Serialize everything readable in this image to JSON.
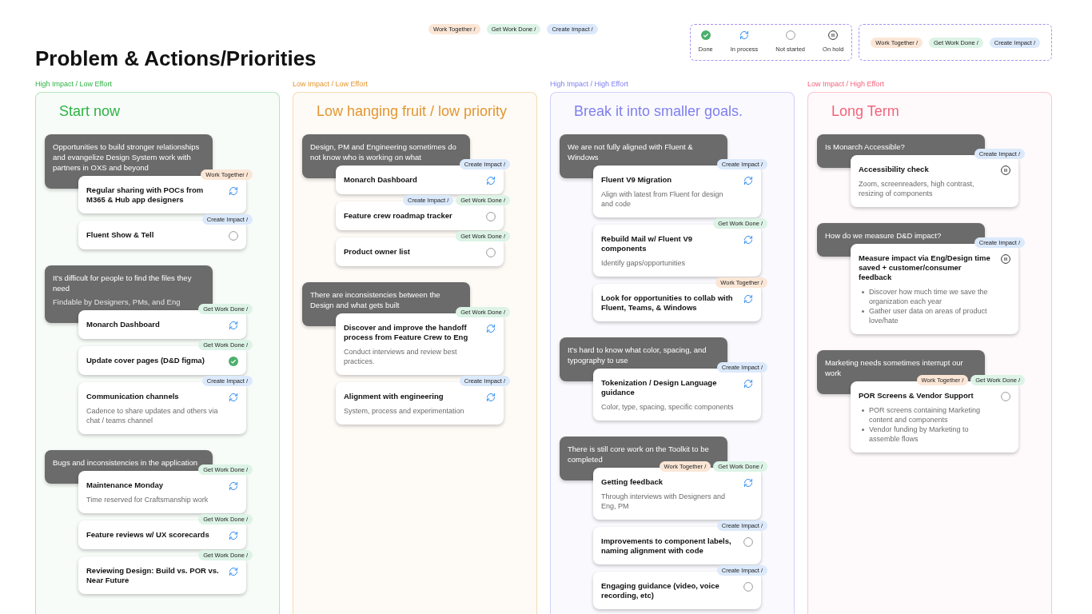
{
  "header_tags": [
    {
      "label": "Work Together /",
      "kind": "together"
    },
    {
      "label": "Get Work Done /",
      "kind": "done"
    },
    {
      "label": "Create Impact /",
      "kind": "impact"
    }
  ],
  "title": "Problem & Actions/Priorities",
  "legend": {
    "statuses": [
      {
        "label": "Done",
        "kind": "done"
      },
      {
        "label": "In process",
        "kind": "in_process"
      },
      {
        "label": "Not started",
        "kind": "not_started"
      },
      {
        "label": "On hold",
        "kind": "on_hold"
      }
    ],
    "tags": [
      {
        "label": "Work Together /",
        "kind": "together"
      },
      {
        "label": "Get Work Done /",
        "kind": "done"
      },
      {
        "label": "Create Impact /",
        "kind": "impact"
      }
    ]
  },
  "columns": [
    {
      "category": "High Impact / Low Effort",
      "heading": "Start now",
      "color": "#2fb344",
      "groups": [
        {
          "problem": "Opportunities to build stronger relationships and evangelize Design System work with partners in OXS and beyond",
          "cards": [
            {
              "title": "Regular sharing with POCs from M365 & Hub app designers",
              "kind": "in_process",
              "tags": [
                {
                  "label": "Work Together /",
                  "kind": "together"
                }
              ]
            },
            {
              "title": "Fluent Show & Tell",
              "kind": "not_started",
              "tags": [
                {
                  "label": "Create Impact /",
                  "kind": "impact"
                }
              ]
            }
          ]
        },
        {
          "problem": "It’s difficult for people to find the files they need",
          "note": "Findable by Designers, PMs, and Eng",
          "cards": [
            {
              "title": "Monarch Dashboard",
              "kind": "in_process",
              "tags": [
                {
                  "label": "Get Work Done /",
                  "kind": "done"
                }
              ]
            },
            {
              "title": "Update cover pages (D&D figma)",
              "kind": "done",
              "tags": [
                {
                  "label": "Get Work Done /",
                  "kind": "done"
                }
              ]
            },
            {
              "title": "Communication channels",
              "description": "Cadence to share updates and others via chat / teams channel",
              "kind": "in_process",
              "tags": [
                {
                  "label": "Create Impact /",
                  "kind": "impact"
                }
              ]
            }
          ]
        },
        {
          "problem": "Bugs and inconsistencies in the application",
          "cards": [
            {
              "title": "Maintenance Monday",
              "description": "Time reserved for Craftsmanship work",
              "kind": "in_process",
              "tags": [
                {
                  "label": "Get Work Done /",
                  "kind": "done"
                }
              ]
            },
            {
              "title": "Feature reviews w/ UX scorecards",
              "kind": "in_process",
              "tags": [
                {
                  "label": "Get Work Done /",
                  "kind": "done"
                }
              ]
            },
            {
              "title": "Reviewing Design: Build vs. POR vs. Near Future",
              "kind": "in_process",
              "tags": [
                {
                  "label": "Get Work Done /",
                  "kind": "done"
                }
              ]
            }
          ]
        }
      ]
    },
    {
      "category": "Low Impact / Low Effort",
      "heading": "Low hanging fruit / low priority",
      "color": "#e3962f",
      "groups": [
        {
          "problem": "Design, PM and Engineering sometimes do not know who is working on what",
          "cards": [
            {
              "title": "Monarch Dashboard",
              "kind": "in_process",
              "tags": [
                {
                  "label": "Create Impact /",
                  "kind": "impact"
                }
              ]
            },
            {
              "title": "Feature crew roadmap tracker",
              "kind": "not_started",
              "tags": [
                {
                  "label": "Create Impact /",
                  "kind": "impact"
                },
                {
                  "label": "Get Work Done /",
                  "kind": "done"
                }
              ]
            },
            {
              "title": "Product owner list",
              "kind": "not_started",
              "tags": [
                {
                  "label": "Get Work Done /",
                  "kind": "done"
                }
              ]
            }
          ]
        },
        {
          "problem": "There are inconsistencies between the Design and what gets built",
          "cards": [
            {
              "title": "Discover and improve the handoff process from Feature Crew to Eng",
              "description": "Conduct interviews and review best practices.",
              "kind": "in_process",
              "tags": [
                {
                  "label": "Get Work Done /",
                  "kind": "done"
                }
              ]
            },
            {
              "title": "Alignment with engineering",
              "description": "System, process and experimentation",
              "kind": "in_process",
              "tags": [
                {
                  "label": "Create Impact /",
                  "kind": "impact"
                }
              ]
            }
          ]
        }
      ]
    },
    {
      "category": "High Impact / High Effort",
      "heading": "Break it into smaller goals.",
      "color": "#7f7ff0",
      "groups": [
        {
          "problem": "We are not fully aligned with Fluent & Windows",
          "cards": [
            {
              "title": "Fluent V9 Migration",
              "description": "Align with latest from Fluent for design and code",
              "kind": "in_process",
              "tags": [
                {
                  "label": "Create Impact /",
                  "kind": "impact"
                }
              ]
            },
            {
              "title": "Rebuild Mail w/ Fluent V9 components",
              "description": "Identify gaps/opportunities",
              "kind": "in_process",
              "tags": [
                {
                  "label": "Get Work Done /",
                  "kind": "done"
                }
              ]
            },
            {
              "title": "Look for opportunities to collab with Fluent, Teams, & Windows",
              "kind": "in_process",
              "tags": [
                {
                  "label": "Work Together /",
                  "kind": "together"
                }
              ]
            }
          ]
        },
        {
          "problem": "It’s hard to know what color, spacing, and typography to use",
          "cards": [
            {
              "title": "Tokenization / Design Language guidance",
              "description": "Color, type, spacing, specific components",
              "kind": "in_process",
              "tags": [
                {
                  "label": "Create Impact /",
                  "kind": "impact"
                }
              ]
            }
          ]
        },
        {
          "problem": "There is still core work on the Toolkit to be completed",
          "cards": [
            {
              "title": "Getting feedback",
              "description": "Through interviews with Designers and Eng, PM",
              "kind": "in_process",
              "tags": [
                {
                  "label": "Work Together /",
                  "kind": "together"
                },
                {
                  "label": "Get Work Done /",
                  "kind": "done"
                }
              ]
            },
            {
              "title": "Improvements to component labels, naming alignment with code",
              "kind": "not_started",
              "tags": [
                {
                  "label": "Create Impact /",
                  "kind": "impact"
                }
              ]
            },
            {
              "title": "Engaging guidance (video, voice recording, etc)",
              "kind": "not_started",
              "tags": [
                {
                  "label": "Create Impact /",
                  "kind": "impact"
                }
              ]
            }
          ]
        }
      ]
    },
    {
      "category": "Low Impact / High Effort",
      "heading": "Long Term",
      "color": "#f2647c",
      "groups": [
        {
          "problem": "Is Monarch Accessible?",
          "cards": [
            {
              "title": "Accessibility check",
              "description": "Zoom, screenreaders, high contrast, resizing of components",
              "kind": "on_hold",
              "tags": [
                {
                  "label": "Create Impact /",
                  "kind": "impact"
                }
              ]
            }
          ]
        },
        {
          "problem": "How do we measure D&D impact?",
          "cards": [
            {
              "title": "Measure impact via Eng/Design time saved + customer/consumer feedback",
              "bullets": [
                "Discover how much time we save the organization each year",
                "Gather user data on areas of product love/hate"
              ],
              "kind": "on_hold",
              "tags": [
                {
                  "label": "Create Impact /",
                  "kind": "impact"
                }
              ]
            }
          ]
        },
        {
          "problem": "Marketing needs sometimes interrupt our work",
          "cards": [
            {
              "title": "POR Screens & Vendor Support",
              "bullets": [
                "POR screens containing Marketing content and components",
                "Vendor funding by Marketing to assemble flows"
              ],
              "kind": "not_started",
              "tags": [
                {
                  "label": "Work Together /",
                  "kind": "together"
                },
                {
                  "label": "Get Work Done /",
                  "kind": "done"
                }
              ]
            }
          ]
        }
      ]
    }
  ]
}
